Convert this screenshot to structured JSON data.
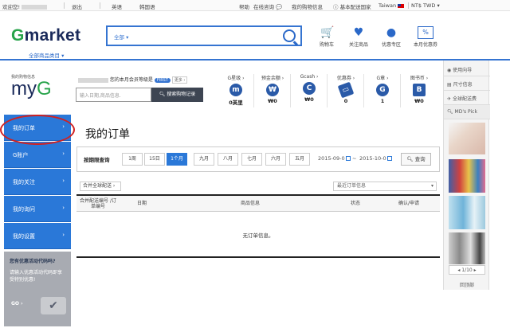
{
  "topbar": {
    "welcome": "欢迎您!",
    "logout": "退出",
    "english": "英语",
    "korean": "韩国语",
    "help": "帮助",
    "online_consult": "在线咨询",
    "my_shopping": "我的购物信息",
    "basic_country": "基本配送国家",
    "country": "Taiwan",
    "currency": "NT$ TWD ▾"
  },
  "header": {
    "logo_g": "G",
    "logo_rest": "market",
    "search_category": "全部",
    "cart": "购物车",
    "favorites": "关注商品",
    "deals": "优惠专区",
    "monthly_coupon": "本月优惠券",
    "all_categories": "全部商品类目 ▾"
  },
  "myg": {
    "small": "我的购物信息",
    "logo_my": "my",
    "logo_g": "G",
    "grade_text": "您的本月会员等级是",
    "grade_badge": "FIRST",
    "more": "更多 ›",
    "search_placeholder": "输入日期,商品信息.",
    "search_button": "搜索购物记录"
  },
  "stats": [
    {
      "label": "G星级 ›",
      "icon": "m",
      "value": "0英里"
    },
    {
      "label": "预金余额 ›",
      "icon": "₩",
      "value": "₩0"
    },
    {
      "label": "Gcash ›",
      "icon": "C",
      "value": "₩0"
    },
    {
      "label": "优惠券 ›",
      "icon": "▭",
      "value": "0"
    },
    {
      "label": "G章 ›",
      "icon": "G",
      "value": "1"
    },
    {
      "label": "图书币 ›",
      "icon": "B",
      "value": "₩0"
    }
  ],
  "right_panel": {
    "guide": "使用向导",
    "size_info": "尺寸信息",
    "global_ship_fee": "全球配送费",
    "mds_pick": "MD's Pick",
    "pager": "◂ 1/10 ▸",
    "back_top": "回顶部"
  },
  "sidebar": {
    "items": [
      "我的订单",
      "G账户",
      "我的关注",
      "我的询问",
      "我的设置"
    ],
    "promo_title": "您有优惠活动代码吗?",
    "promo_text": "请输入优惠活动代码即享受特别优惠!",
    "promo_go": "GO ›"
  },
  "main": {
    "title": "我的订单",
    "filter_label": "按期限查询",
    "periods": [
      "1周",
      "15日",
      "1个月",
      "九月",
      "八月",
      "七月",
      "六月",
      "五月"
    ],
    "active_period": "1个月",
    "date_from": "2015-09-0",
    "date_to": "2015-10-0",
    "query_button": "查询",
    "global_ship": "合并全球配送 ›",
    "sort_select": "最近订单信息",
    "columns": [
      "合并配送编号 /订单编号",
      "日期",
      "商品信息",
      "状态",
      "确认/申请"
    ],
    "empty": "无订单信息。"
  },
  "colors": {
    "accent": "#2a78d8",
    "brand_navy": "#1a2a5a",
    "brand_green": "#27a34a",
    "highlight": "#d02020"
  }
}
